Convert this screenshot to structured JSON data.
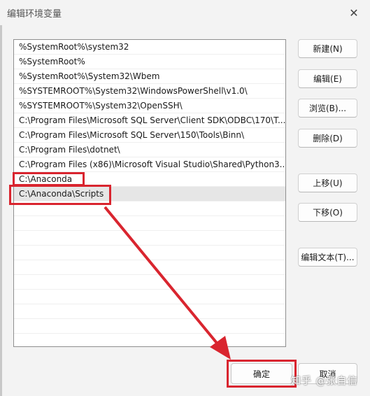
{
  "window": {
    "title": "编辑环境变量",
    "close_glyph": "✕"
  },
  "paths": [
    "%SystemRoot%\\system32",
    "%SystemRoot%",
    "%SystemRoot%\\System32\\Wbem",
    "%SYSTEMROOT%\\System32\\WindowsPowerShell\\v1.0\\",
    "%SYSTEMROOT%\\System32\\OpenSSH\\",
    "C:\\Program Files\\Microsoft SQL Server\\Client SDK\\ODBC\\170\\T...",
    "C:\\Program Files\\Microsoft SQL Server\\150\\Tools\\Binn\\",
    "C:\\Program Files\\dotnet\\",
    "C:\\Program Files (x86)\\Microsoft Visual Studio\\Shared\\Python3...",
    "C:\\Anaconda",
    "C:\\Anaconda\\Scripts"
  ],
  "selected_index": 10,
  "buttons": {
    "new": "新建(N)",
    "edit": "编辑(E)",
    "browse": "浏览(B)...",
    "delete": "删除(D)",
    "move_up": "上移(U)",
    "move_down": "下移(O)",
    "edit_text": "编辑文本(T)...",
    "ok": "确定",
    "cancel": "取消"
  },
  "watermark": "知乎 @张自信",
  "colors": {
    "highlight": "#d9252f",
    "selection": "#e6e6e6"
  }
}
